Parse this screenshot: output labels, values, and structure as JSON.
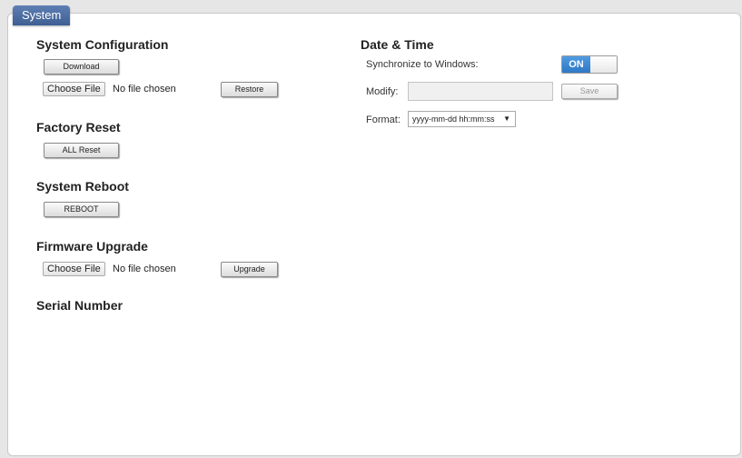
{
  "tab": {
    "label": "System"
  },
  "system_configuration": {
    "heading": "System Configuration",
    "download_label": "Download",
    "choose_file_label": "Choose File",
    "file_status": "No file chosen",
    "restore_label": "Restore"
  },
  "factory_reset": {
    "heading": "Factory Reset",
    "button_label": "ALL Reset"
  },
  "system_reboot": {
    "heading": "System Reboot",
    "button_label": "REBOOT"
  },
  "firmware_upgrade": {
    "heading": "Firmware Upgrade",
    "choose_file_label": "Choose File",
    "file_status": "No file chosen",
    "upgrade_label": "Upgrade"
  },
  "serial_number": {
    "heading": "Serial Number"
  },
  "date_time": {
    "heading": "Date & Time",
    "sync_label": "Synchronize to Windows:",
    "sync_toggle": "ON",
    "modify_label": "Modify:",
    "modify_value": "",
    "save_label": "Save",
    "format_label": "Format:",
    "format_selected": "yyyy-mm-dd hh:mm:ss"
  }
}
